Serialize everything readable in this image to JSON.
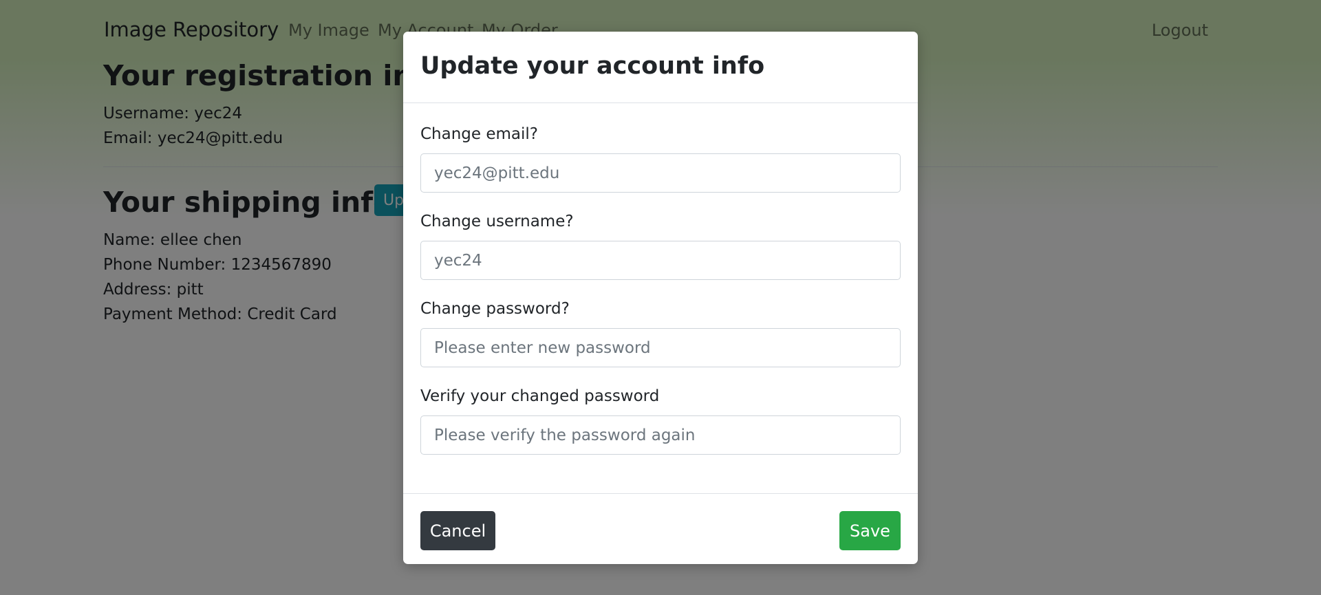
{
  "navbar": {
    "brand": "Image Repository",
    "links": [
      "My Image",
      "My Account",
      "My Order"
    ],
    "logout": "Logout"
  },
  "registration": {
    "title": "Your registration info",
    "username_line": "Username: yec24",
    "email_line": "Email: yec24@pitt.edu"
  },
  "shipping": {
    "title": "Your shipping info",
    "update_button": "Update",
    "name_line": "Name: ellee chen",
    "phone_line": "Phone Number: 1234567890",
    "address_line": "Address: pitt",
    "payment_line": "Payment Method: Credit Card"
  },
  "modal": {
    "title": "Update your account info",
    "fields": [
      {
        "label": "Change email?",
        "placeholder": "yec24@pitt.edu"
      },
      {
        "label": "Change username?",
        "placeholder": "yec24"
      },
      {
        "label": "Change password?",
        "placeholder": "Please enter new password"
      },
      {
        "label": "Verify your changed password",
        "placeholder": "Please verify the password again"
      }
    ],
    "cancel": "Cancel",
    "save": "Save"
  },
  "colors": {
    "navbar_bg": "#d4efbd",
    "cancel_button": "#343a40",
    "save_button": "#28a745",
    "update_button": "#17a2b8"
  }
}
